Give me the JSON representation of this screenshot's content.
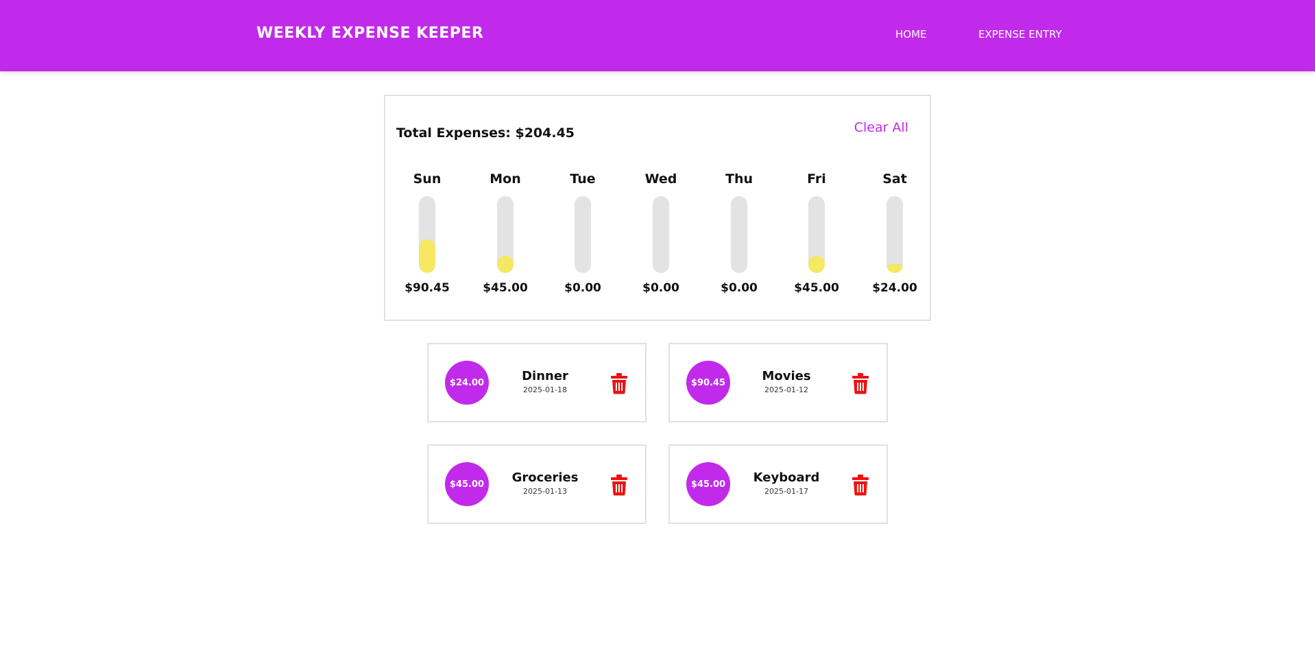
{
  "header": {
    "brand": "Weekly Expense Keeper",
    "nav": [
      {
        "label": "HOME"
      },
      {
        "label": "EXPENSE ENTRY"
      }
    ]
  },
  "summary": {
    "total_label": "Total Expenses: $204.45",
    "clear_all_label": "Clear All",
    "days": [
      {
        "name": "Sun",
        "amount": "$90.45",
        "fill_fraction": 0.44
      },
      {
        "name": "Mon",
        "amount": "$45.00",
        "fill_fraction": 0.22
      },
      {
        "name": "Tue",
        "amount": "$0.00",
        "fill_fraction": 0
      },
      {
        "name": "Wed",
        "amount": "$0.00",
        "fill_fraction": 0
      },
      {
        "name": "Thu",
        "amount": "$0.00",
        "fill_fraction": 0
      },
      {
        "name": "Fri",
        "amount": "$45.00",
        "fill_fraction": 0.22
      },
      {
        "name": "Sat",
        "amount": "$24.00",
        "fill_fraction": 0.12
      }
    ]
  },
  "expenses": [
    {
      "amount": "$24.00",
      "title": "Dinner",
      "date": "2025-01-18"
    },
    {
      "amount": "$90.45",
      "title": "Movies",
      "date": "2025-01-12"
    },
    {
      "amount": "$45.00",
      "title": "Groceries",
      "date": "2025-01-13"
    },
    {
      "amount": "$45.00",
      "title": "Keyboard",
      "date": "2025-01-17"
    }
  ],
  "icons": {
    "delete": "trash-icon"
  },
  "colors": {
    "accent": "#c12aea",
    "bar_fill": "#f5e862",
    "bar_track": "#e3e3e3",
    "delete": "#ee1111"
  }
}
